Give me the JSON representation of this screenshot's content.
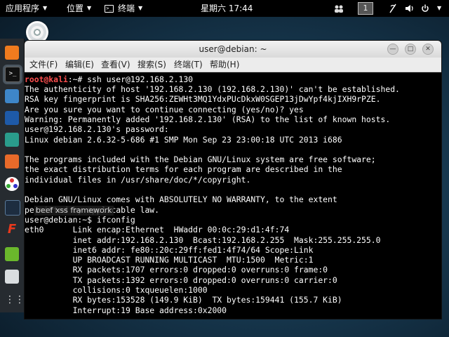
{
  "panel": {
    "apps": "应用程序",
    "places": "位置",
    "terminal": "终端",
    "clock": "星期六 17:44",
    "workspace": "1"
  },
  "window": {
    "title": "user@debian: ~",
    "menu": [
      "文件(F)",
      "编辑(E)",
      "查看(V)",
      "搜索(S)",
      "终端(T)",
      "帮助(H)"
    ]
  },
  "terminal": {
    "prompt_root": "root@kali",
    "line1_cmd": ":~# ssh user@192.168.2.130",
    "lines": [
      "The authenticity of host '192.168.2.130 (192.168.2.130)' can't be established.",
      "RSA key fingerprint is SHA256:ZEWHt3MQ1YdxPUcDkxW0SGEP13jDwYpf4kjIXH9rPZE.",
      "Are you sure you want to continue connecting (yes/no)? yes",
      "Warning: Permanently added '192.168.2.130' (RSA) to the list of known hosts.",
      "user@192.168.2.130's password:",
      "Linux debian 2.6.32-5-686 #1 SMP Mon Sep 23 23:00:18 UTC 2013 i686",
      "",
      "The programs included with the Debian GNU/Linux system are free software;",
      "the exact distribution terms for each program are described in the",
      "individual files in /usr/share/doc/*/copyright.",
      "",
      "Debian GNU/Linux comes with ABSOLUTELY NO WARRANTY, to the extent",
      "permitted by applicable law.",
      "user@debian:~$ ifconfig",
      "eth0      Link encap:Ethernet  HWaddr 00:0c:29:d1:4f:74",
      "          inet addr:192.168.2.130  Bcast:192.168.2.255  Mask:255.255.255.0",
      "          inet6 addr: fe80::20c:29ff:fed1:4f74/64 Scope:Link",
      "          UP BROADCAST RUNNING MULTICAST  MTU:1500  Metric:1",
      "          RX packets:1707 errors:0 dropped:0 overruns:0 frame:0",
      "          TX packets:1392 errors:0 dropped:0 overruns:0 carrier:0",
      "          collisions:0 txqueuelen:1000",
      "          RX bytes:153528 (149.9 KiB)  TX bytes:159441 (155.7 KiB)",
      "          Interrupt:19 Base address:0x2000"
    ]
  },
  "dock_tooltip": "beef xss framework",
  "colors": {
    "root_prompt": "#ff4f4f",
    "terminal_bg": "#000000",
    "terminal_fg": "#ffffff"
  }
}
